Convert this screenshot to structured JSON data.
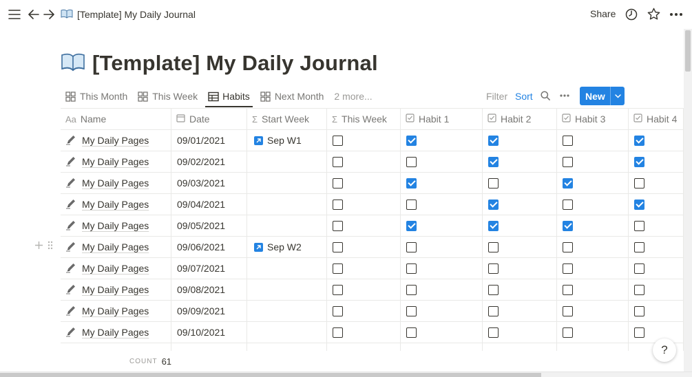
{
  "topbar": {
    "breadcrumb_title": "[Template] My Daily Journal",
    "share_label": "Share"
  },
  "page": {
    "title": "[Template] My Daily Journal",
    "icon": "open-book-icon"
  },
  "views": {
    "tabs": [
      {
        "label": "This Month",
        "icon": "gallery-icon",
        "active": false
      },
      {
        "label": "This Week",
        "icon": "gallery-icon",
        "active": false
      },
      {
        "label": "Habits",
        "icon": "table-icon",
        "active": true
      },
      {
        "label": "Next Month",
        "icon": "gallery-icon",
        "active": false
      }
    ],
    "more_label": "2 more...",
    "filter_label": "Filter",
    "sort_label": "Sort",
    "new_label": "New"
  },
  "table": {
    "columns": [
      {
        "label": "Name",
        "icon": "Aa"
      },
      {
        "label": "Date",
        "icon": "calendar-icon"
      },
      {
        "label": "Start Week",
        "icon": "Σ"
      },
      {
        "label": "This Week",
        "icon": "Σ"
      },
      {
        "label": "Habit 1",
        "icon": "checkbox-icon"
      },
      {
        "label": "Habit 2",
        "icon": "checkbox-icon"
      },
      {
        "label": "Habit 3",
        "icon": "checkbox-icon"
      },
      {
        "label": "Habit 4",
        "icon": "checkbox-icon"
      }
    ],
    "rows": [
      {
        "name": "My Daily Pages",
        "date": "09/01/2021",
        "start_week": "Sep W1",
        "this_week": false,
        "h1": true,
        "h2": true,
        "h3": false,
        "h4": true
      },
      {
        "name": "My Daily Pages",
        "date": "09/02/2021",
        "start_week": "",
        "this_week": false,
        "h1": false,
        "h2": true,
        "h3": false,
        "h4": true
      },
      {
        "name": "My Daily Pages",
        "date": "09/03/2021",
        "start_week": "",
        "this_week": false,
        "h1": true,
        "h2": false,
        "h3": true,
        "h4": false
      },
      {
        "name": "My Daily Pages",
        "date": "09/04/2021",
        "start_week": "",
        "this_week": false,
        "h1": false,
        "h2": true,
        "h3": false,
        "h4": true
      },
      {
        "name": "My Daily Pages",
        "date": "09/05/2021",
        "start_week": "",
        "this_week": false,
        "h1": true,
        "h2": true,
        "h3": true,
        "h4": false
      },
      {
        "name": "My Daily Pages",
        "date": "09/06/2021",
        "start_week": "Sep W2",
        "this_week": false,
        "h1": false,
        "h2": false,
        "h3": false,
        "h4": false
      },
      {
        "name": "My Daily Pages",
        "date": "09/07/2021",
        "start_week": "",
        "this_week": false,
        "h1": false,
        "h2": false,
        "h3": false,
        "h4": false
      },
      {
        "name": "My Daily Pages",
        "date": "09/08/2021",
        "start_week": "",
        "this_week": false,
        "h1": false,
        "h2": false,
        "h3": false,
        "h4": false
      },
      {
        "name": "My Daily Pages",
        "date": "09/09/2021",
        "start_week": "",
        "this_week": false,
        "h1": false,
        "h2": false,
        "h3": false,
        "h4": false
      },
      {
        "name": "My Daily Pages",
        "date": "09/10/2021",
        "start_week": "",
        "this_week": false,
        "h1": false,
        "h2": false,
        "h3": false,
        "h4": false
      }
    ]
  },
  "footer": {
    "count_label": "COUNT",
    "count_value": "61",
    "help_label": "?"
  },
  "colors": {
    "accent": "#2383e2",
    "text": "#37352f",
    "muted": "#787774",
    "border": "#e9e9e7"
  }
}
